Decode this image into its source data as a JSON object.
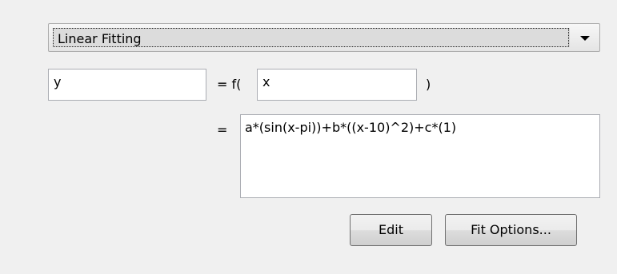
{
  "fit_type": {
    "selected": "Linear Fitting"
  },
  "equation": {
    "output_var": "y",
    "equals_f_label": "= f(",
    "input_var": "x",
    "close_paren": ")",
    "equals_label": "=",
    "expression": "a*(sin(x-pi))+b*((x-10)^2)+c*(1)"
  },
  "buttons": {
    "edit_label": "Edit",
    "fit_options_label": "Fit Options..."
  },
  "icons": {
    "dropdown_arrow": "chevron-down-icon"
  }
}
